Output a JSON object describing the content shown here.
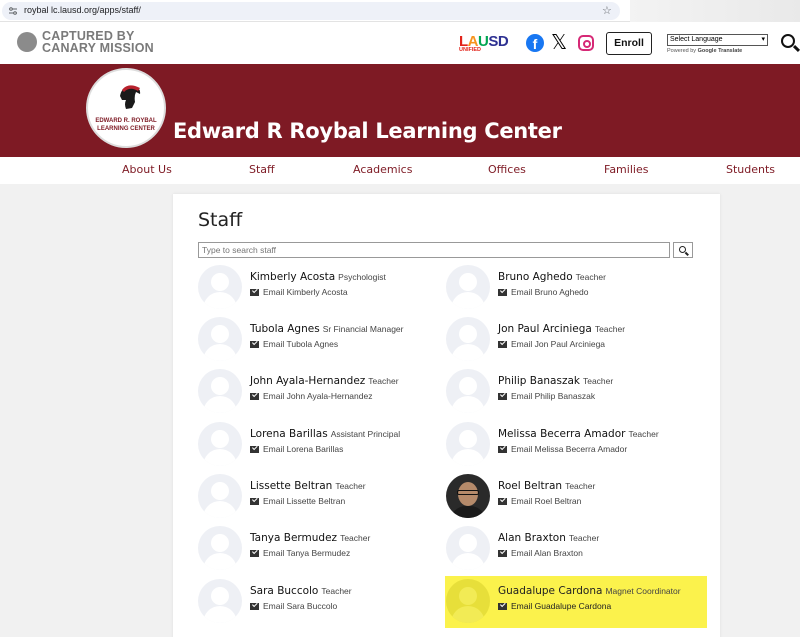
{
  "browser": {
    "url": "roybal lc.lausd.org/apps/staff/"
  },
  "header": {
    "watermark_line1": "CAPTURED BY",
    "watermark_line2": "CANARY MISSION",
    "logo_letters": [
      "L",
      "A",
      "U",
      "S",
      "D"
    ],
    "logo_sub": "UNIFIED",
    "enroll_label": "Enroll",
    "language_select": "Select Language",
    "powered_by_prefix": "Powered by",
    "powered_by_brand": "Google",
    "powered_by_suffix": "Translate"
  },
  "banner": {
    "seal_line1": "EDWARD R. ROYBAL",
    "seal_line2": "LEARNING CENTER",
    "school_name": "Edward R Roybal Learning Center",
    "color": "#7e1a24"
  },
  "nav": {
    "items": [
      {
        "label": "About Us"
      },
      {
        "label": "Staff"
      },
      {
        "label": "Academics"
      },
      {
        "label": "Offices"
      },
      {
        "label": "Families"
      },
      {
        "label": "Students"
      }
    ]
  },
  "main": {
    "title": "Staff",
    "search_placeholder": "Type to search staff",
    "staff": [
      {
        "name": "Kimberly Acosta",
        "role": "Psychologist",
        "email": "Email Kimberly Acosta"
      },
      {
        "name": "Bruno Aghedo",
        "role": "Teacher",
        "email": "Email Bruno Aghedo"
      },
      {
        "name": "Tubola Agnes",
        "role": "Sr Financial Manager",
        "email": "Email Tubola Agnes"
      },
      {
        "name": "Jon Paul Arciniega",
        "role": "Teacher",
        "email": "Email Jon Paul Arciniega"
      },
      {
        "name": "John Ayala-Hernandez",
        "role": "Teacher",
        "email": "Email John Ayala-Hernandez"
      },
      {
        "name": "Philip Banaszak",
        "role": "Teacher",
        "email": "Email Philip Banaszak"
      },
      {
        "name": "Lorena Barillas",
        "role": "Assistant Principal",
        "email": "Email Lorena Barillas"
      },
      {
        "name": "Melissa Becerra Amador",
        "role": "Teacher",
        "email": "Email Melissa Becerra Amador"
      },
      {
        "name": "Lissette Beltran",
        "role": "Teacher",
        "email": "Email Lissette Beltran"
      },
      {
        "name": "Roel Beltran",
        "role": "Teacher",
        "email": "Email Roel Beltran"
      },
      {
        "name": "Tanya Bermudez",
        "role": "Teacher",
        "email": "Email Tanya Bermudez"
      },
      {
        "name": "Alan Braxton",
        "role": "Teacher",
        "email": "Email Alan Braxton"
      },
      {
        "name": "Sara Buccolo",
        "role": "Teacher",
        "email": "Email Sara Buccolo"
      },
      {
        "name": "Guadalupe Cardona",
        "role": "Magnet Coordinator",
        "email": "Email Guadalupe Cardona"
      }
    ],
    "highlight_color": "#fbf24c"
  }
}
